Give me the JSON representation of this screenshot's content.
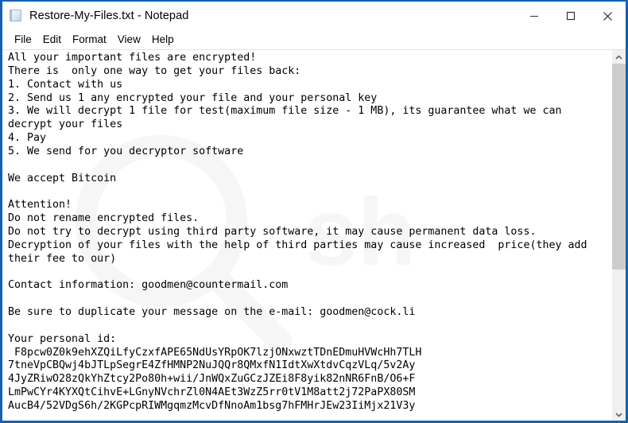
{
  "window": {
    "title": "Restore-My-Files.txt - Notepad",
    "icon": "notepad-document-icon",
    "border_color": "#1461b0",
    "controls": [
      {
        "name": "minimize",
        "glyph": "minimize-icon"
      },
      {
        "name": "maximize",
        "glyph": "maximize-icon"
      },
      {
        "name": "close",
        "glyph": "close-icon"
      }
    ]
  },
  "menu": {
    "items": [
      {
        "label": "File"
      },
      {
        "label": "Edit"
      },
      {
        "label": "Format"
      },
      {
        "label": "View"
      },
      {
        "label": "Help"
      }
    ]
  },
  "document": {
    "filename": "Restore-My-Files.txt",
    "lines": [
      "All your important files are encrypted!",
      "There is  only one way to get your files back:",
      "1. Contact with us",
      "2. Send us 1 any encrypted your file and your personal key",
      "3. We will decrypt 1 file for test(maximum file size - 1 MB), its guarantee what we can",
      "decrypt your files",
      "4. Pay",
      "5. We send for you decryptor software",
      "",
      "We accept Bitcoin",
      "",
      "Attention!",
      "Do not rename encrypted files.",
      "Do not try to decrypt using third party software, it may cause permanent data loss.",
      "Decryption of your files with the help of third parties may cause increased  price(they add",
      "their fee to our)",
      "",
      "Contact information: goodmen@countermail.com",
      "",
      "Be sure to duplicate your message on the e-mail: goodmen@cock.li",
      "",
      "Your personal id:",
      " F8pcw0Z0k9ehXZQiLfyCzxfAPE65NdUsYRpOK7lzjONxwztTDnEDmuHVWcHh7TLH",
      "7tneVpCBQwj4bJTLpSegrE4ZfHMNP2NuJQQr8QMxfN1IdtXwXtdvCqzVLq/5v2Ay",
      "4JyZRiwO28zQkYhZtcy2Po80h+wii/JnWQxZuGCzJZEi8F8yik82nNR6FnB/O6+F",
      "LmPwCYr4KYXQtCihvE+LGnyNVchrZl0N4AEt3WzZ5rr0tV1M8att2j72PaPX80SM",
      "AucB4/52VDgS6h/2KGPcpRIWMgqmzMcvDfNnoAm1bsg7hFMHrJEw23IiMjx21V3y"
    ],
    "contact_email_primary": "goodmen@countermail.com",
    "contact_email_secondary": "goodmen@cock.li",
    "payment_method": "Bitcoin"
  },
  "scrollbar": {
    "up_arrow": "chevron-up-icon",
    "down_arrow": "chevron-down-icon",
    "thumb_fraction": "60%"
  }
}
